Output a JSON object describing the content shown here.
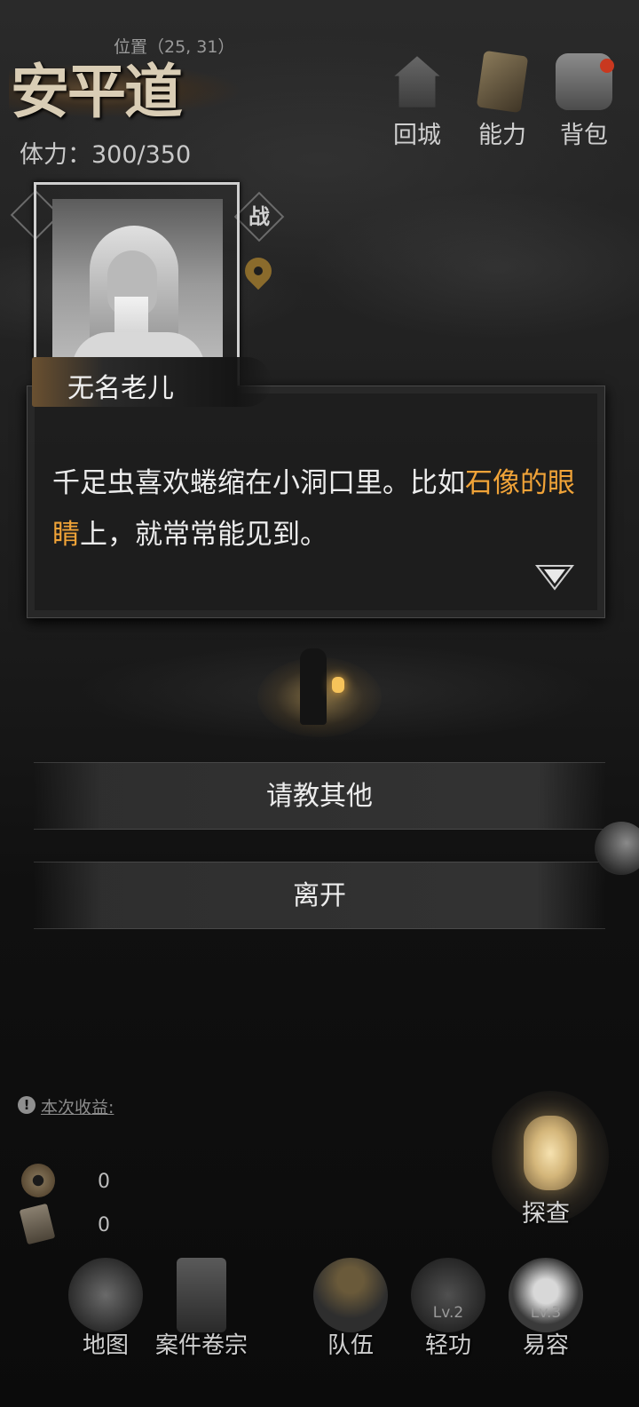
{
  "header": {
    "location_name": "安平道",
    "position_label": "位置（25, 31）",
    "stamina": "体力：300/350"
  },
  "top_buttons": [
    {
      "label": "回城",
      "icon": "city-gate-icon"
    },
    {
      "label": "能力",
      "icon": "scroll-book-icon"
    },
    {
      "label": "背包",
      "icon": "bag-icon",
      "has_notification": true
    }
  ],
  "map_deco": {
    "battle_marker": "战"
  },
  "npc": {
    "name": "无名老儿"
  },
  "dialog": {
    "text_part1": "千足虫喜欢蜷缩在小洞口里。比如",
    "highlight": "石像的眼睛",
    "text_part2": "上，就常常能见到。",
    "highlight_color": "#f0a338"
  },
  "options": [
    {
      "label": "请教其他"
    },
    {
      "label": "离开"
    }
  ],
  "income": {
    "label": "本次收益:",
    "coins": "0",
    "notes": "0"
  },
  "explore": {
    "label": "探查"
  },
  "bottom_nav": [
    {
      "label": "地图",
      "icon": "map-scroll-icon"
    },
    {
      "label": "案件卷宗",
      "icon": "case-file-icon"
    },
    {
      "label": "队伍",
      "icon": "team-icon"
    },
    {
      "label": "轻功",
      "icon": "boot-icon",
      "level": "Lv.2"
    },
    {
      "label": "易容",
      "icon": "mask-icon",
      "level": "Lv.3"
    }
  ]
}
